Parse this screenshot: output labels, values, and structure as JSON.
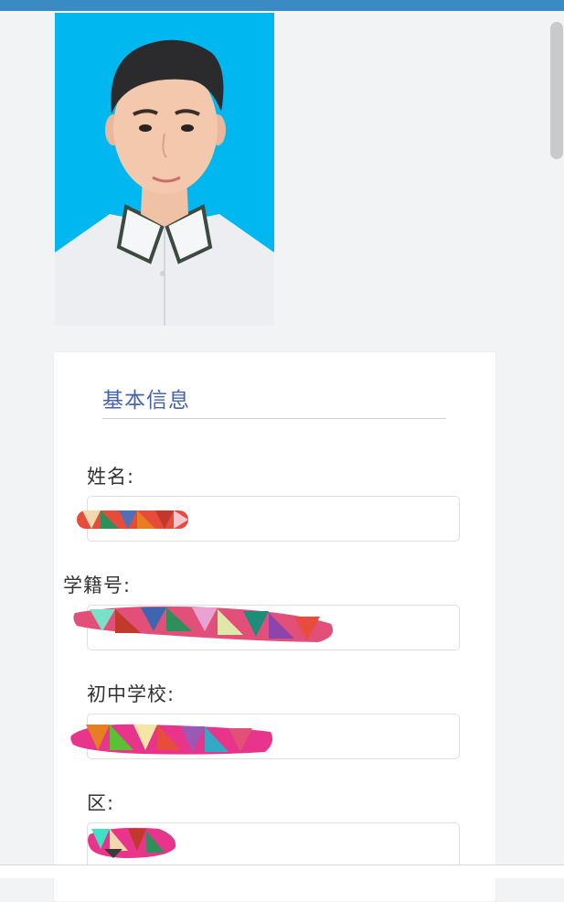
{
  "section": {
    "title": "基本信息"
  },
  "fields": [
    {
      "label": "姓名:",
      "value": ""
    },
    {
      "label": "学籍号:",
      "value": ""
    },
    {
      "label": "初中学校:",
      "value": ""
    },
    {
      "label": "区:",
      "value": ""
    }
  ],
  "colors": {
    "top_bar": "#3a8ac4",
    "photo_background": "#00b8ef",
    "section_title": "#4464ad"
  }
}
